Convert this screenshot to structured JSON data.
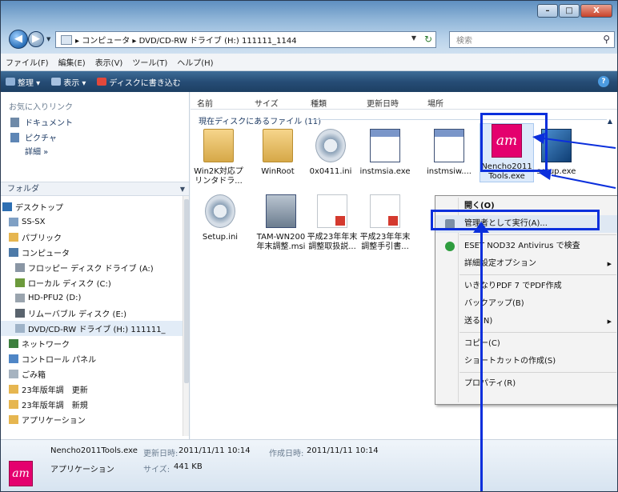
{
  "window": {
    "controls": {
      "minimize": "–",
      "maximize": "□",
      "close": "X"
    },
    "address_path": "▸ コンピュータ ▸ DVD/CD-RW ドライブ (H:) 111111_1144",
    "search_placeholder": "検索"
  },
  "menubar": [
    "ファイル(F)",
    "編集(E)",
    "表示(V)",
    "ツール(T)",
    "ヘルプ(H)"
  ],
  "toolbar": [
    {
      "label": "整理 ▾",
      "icon": "organize-icon",
      "color": "#8fb0d6"
    },
    {
      "label": "表示 ▾",
      "icon": "views-icon",
      "color": "#a8c2e0"
    },
    {
      "label": "ディスクに書き込む",
      "icon": "burn-icon",
      "color": "#e2483b"
    }
  ],
  "sidebar": {
    "favorites_heading": "お気に入りリンク",
    "favorites": [
      {
        "label": "ドキュメント",
        "icon": "documents-icon"
      },
      {
        "label": "ピクチャ",
        "icon": "pictures-icon"
      }
    ],
    "details_link": "詳細 »",
    "folders_heading": "フォルダ",
    "tree": [
      {
        "label": "デスクトップ",
        "indent": 0,
        "icon": "desktop-icon",
        "color": "#2e6fb3"
      },
      {
        "label": "SS-SX",
        "indent": 1,
        "icon": "user-folder-icon",
        "color": "#7fa0c4"
      },
      {
        "label": "パブリック",
        "indent": 1,
        "icon": "folder-icon",
        "color": "#e6b650"
      },
      {
        "label": "コンピュータ",
        "indent": 1,
        "icon": "computer-icon",
        "color": "#4d7aa8"
      },
      {
        "label": "フロッピー ディスク ドライブ (A:)",
        "indent": 2,
        "icon": "floppy-icon",
        "color": "#8a96a4"
      },
      {
        "label": "ローカル ディスク (C:)",
        "indent": 2,
        "icon": "local-disk-icon",
        "color": "#6c9a3c"
      },
      {
        "label": "HD-PFU2 (D:)",
        "indent": 2,
        "icon": "disk-icon",
        "color": "#9aa4ae"
      },
      {
        "label": "リムーバブル ディスク (E:)",
        "indent": 2,
        "icon": "removable-disk-icon",
        "color": "#5a646e"
      },
      {
        "label": "DVD/CD-RW ドライブ (H:) 111111_",
        "indent": 2,
        "icon": "dvd-drive-icon",
        "color": "#9fb3c8",
        "selected": true
      },
      {
        "label": "ネットワーク",
        "indent": 1,
        "icon": "network-icon",
        "color": "#3d7f3e"
      },
      {
        "label": "コントロール パネル",
        "indent": 1,
        "icon": "control-panel-icon",
        "color": "#4f86c6"
      },
      {
        "label": "ごみ箱",
        "indent": 1,
        "icon": "recycle-bin-icon",
        "color": "#a6b3c0"
      },
      {
        "label": "23年版年調　更新",
        "indent": 1,
        "icon": "folder-icon",
        "color": "#e6b650"
      },
      {
        "label": "23年版年調　新規",
        "indent": 1,
        "icon": "folder-icon",
        "color": "#e6b650"
      },
      {
        "label": "アプリケーション",
        "indent": 1,
        "icon": "folder-icon",
        "color": "#e6b650"
      }
    ]
  },
  "columns": [
    "名前",
    "サイズ",
    "種類",
    "更新日時",
    "場所"
  ],
  "group_header": "現在ディスクにあるファイル (11)",
  "files": [
    {
      "label": "Win2K対応プリンタドラ...",
      "icon": "folder-icon",
      "kind": "folder"
    },
    {
      "label": "WinRoot",
      "icon": "folder-icon",
      "kind": "folder"
    },
    {
      "label": "0x0411.ini",
      "icon": "settings-file-icon",
      "kind": "gear"
    },
    {
      "label": "instmsia.exe",
      "icon": "installer-icon",
      "kind": "inst"
    },
    {
      "label": "instmsiw....",
      "icon": "installer-icon",
      "kind": "inst"
    },
    {
      "label": "Nencho2011Tools.exe",
      "icon": "tam-app-icon",
      "kind": "tam",
      "selected": true
    },
    {
      "label": "setup.exe",
      "icon": "setup-icon",
      "kind": "setup"
    },
    {
      "label": "Setup.ini",
      "icon": "settings-file-icon",
      "kind": "gear"
    },
    {
      "label": "TAM-WN200年末調整.msi",
      "icon": "msi-icon",
      "kind": "msi"
    },
    {
      "label": "平成23年年末調整取扱説...",
      "icon": "pdf-icon",
      "kind": "pdf"
    },
    {
      "label": "平成23年年末調整手引書...",
      "icon": "pdf-icon",
      "kind": "pdf"
    }
  ],
  "tam_logo_text": "am",
  "context_menu": [
    {
      "label": "開く(O)",
      "bold": true
    },
    {
      "label": "管理者として実行(A)...",
      "icon": "shield-icon",
      "highlight": true
    },
    {
      "sep": true
    },
    {
      "label": "ESET NOD32 Antivirus で検査",
      "icon": "eset-icon"
    },
    {
      "label": "詳細設定オプション",
      "sub": true
    },
    {
      "sep": true
    },
    {
      "label": "いきなりPDF 7 でPDF作成"
    },
    {
      "label": "バックアップ(B)"
    },
    {
      "label": "送る(N)",
      "sub": true
    },
    {
      "sep": true
    },
    {
      "label": "コピー(C)"
    },
    {
      "label": "ショートカットの作成(S)"
    },
    {
      "sep": true
    },
    {
      "label": "プロパティ(R)"
    }
  ],
  "details": {
    "name": "Nencho2011Tools.exe",
    "type": "アプリケーション",
    "modified_label": "更新日時:",
    "modified": "2011/11/11 10:14",
    "created_label": "作成日時:",
    "created": "2011/11/11 10:14",
    "size_label": "サイズ:",
    "size": "441 KB"
  },
  "colors": {
    "annotation": "#0b2fdc",
    "toolbar": "#264d76"
  }
}
